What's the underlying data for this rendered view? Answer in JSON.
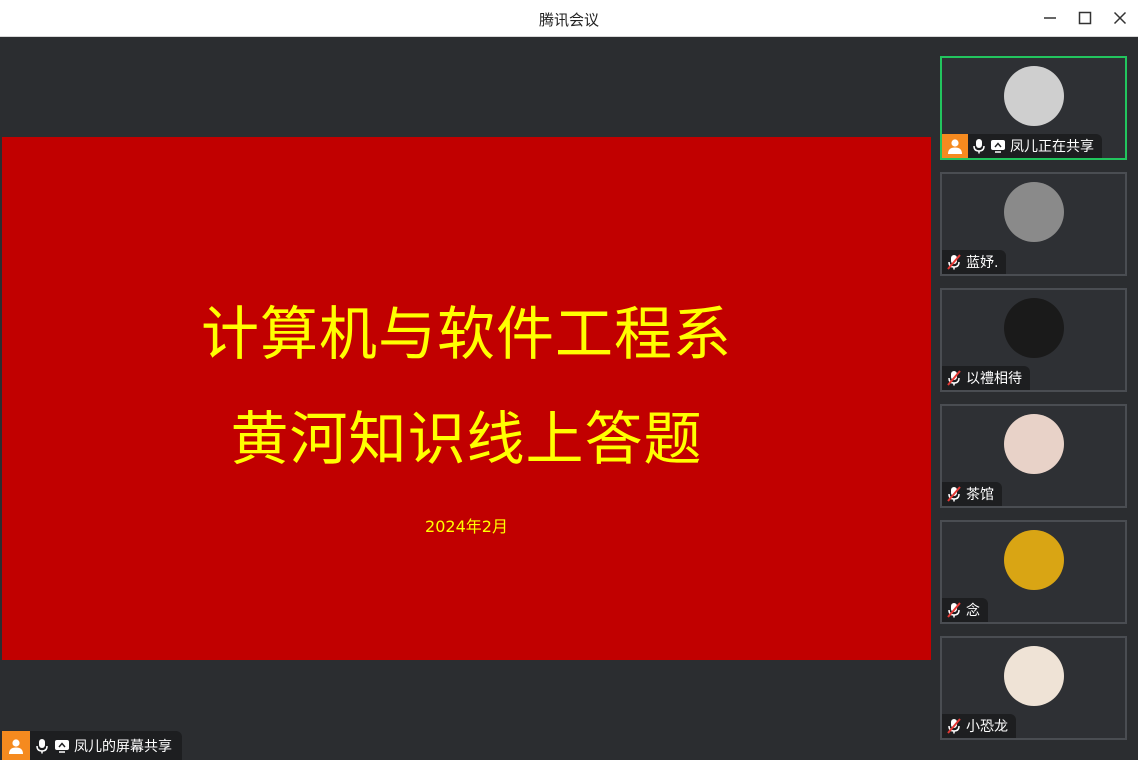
{
  "window": {
    "title": "腾讯会议"
  },
  "slide": {
    "line1": "计算机与软件工程系",
    "line2": "黄河知识线上答题",
    "date": "2024年2月"
  },
  "share": {
    "label": "凤儿的屏幕共享"
  },
  "participants": [
    {
      "name": "凤儿正在共享",
      "state": "sharing",
      "active": true,
      "avatar_color": "#cfcfcf"
    },
    {
      "name": "蓝妤.",
      "state": "muted",
      "active": false,
      "avatar_color": "#8a8a8a"
    },
    {
      "name": "以禮相待",
      "state": "muted",
      "active": false,
      "avatar_color": "#1a1a1a"
    },
    {
      "name": "茶馆",
      "state": "muted",
      "active": false,
      "avatar_color": "#e8d2c8"
    },
    {
      "name": "念",
      "state": "muted",
      "active": false,
      "avatar_color": "#d9a514"
    },
    {
      "name": "小恐龙",
      "state": "muted",
      "active": false,
      "avatar_color": "#efe3d6"
    }
  ],
  "colors": {
    "slide_bg": "#c10000",
    "slide_text": "#ffff00",
    "active_border": "#22c55e",
    "presenter_badge": "#f58a1f"
  }
}
